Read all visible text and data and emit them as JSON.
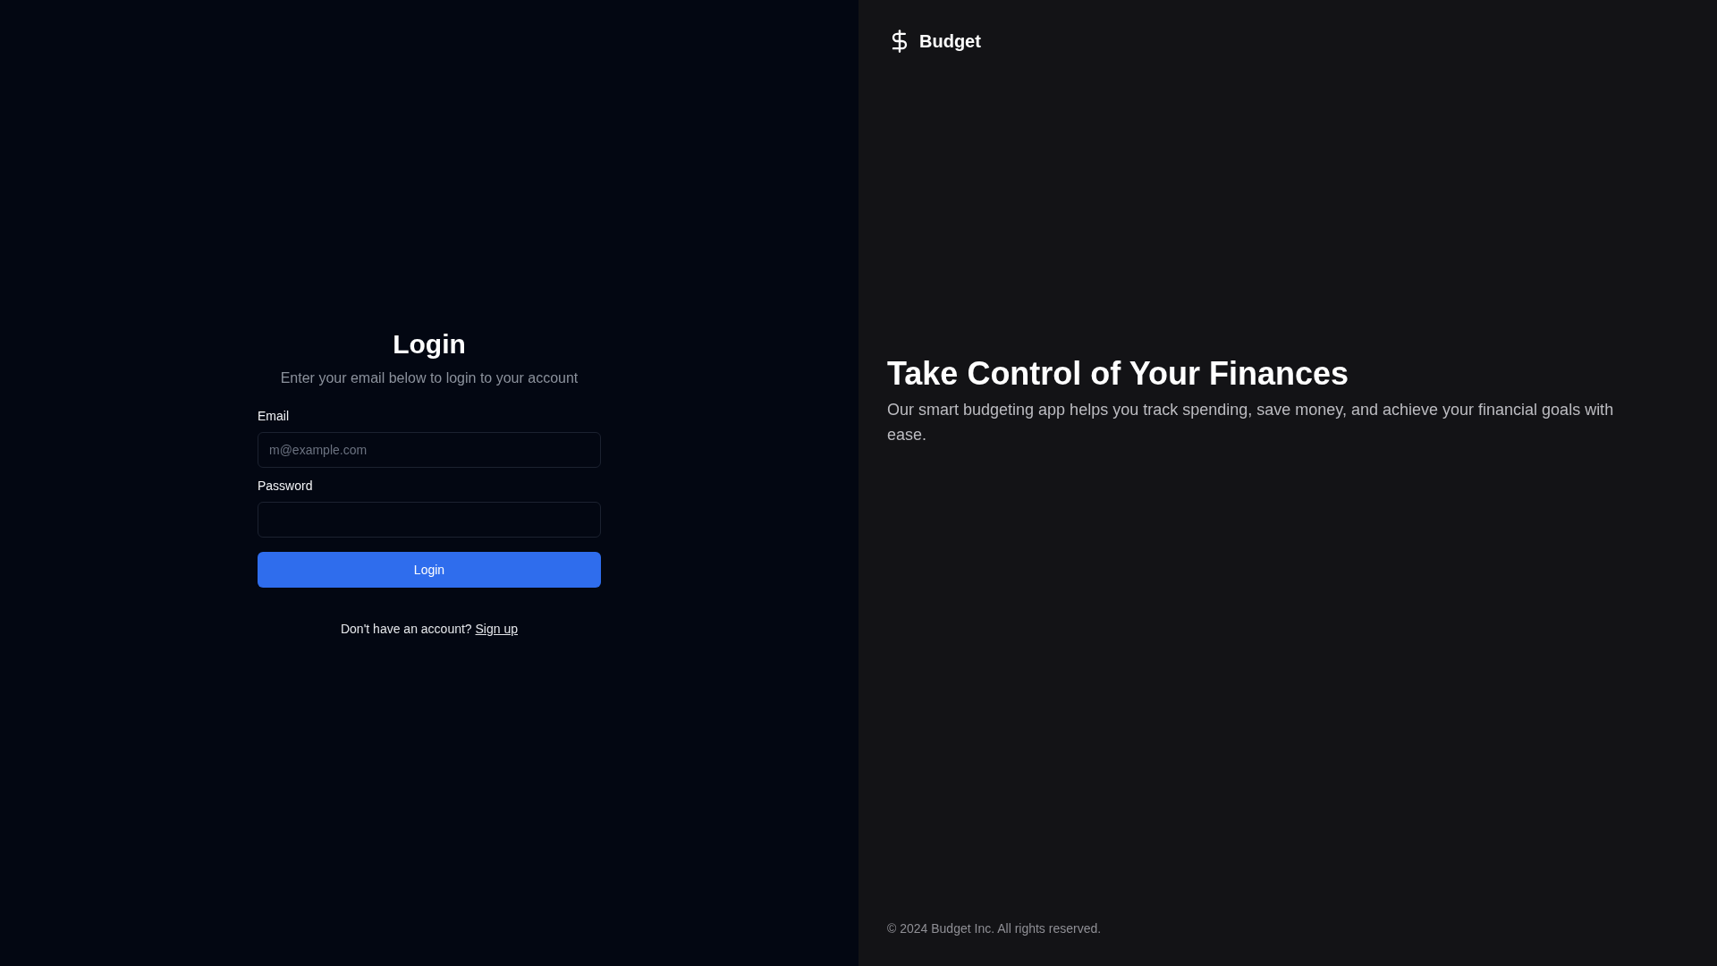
{
  "login": {
    "title": "Login",
    "subtitle": "Enter your email below to login to your account",
    "fields": [
      {
        "label": "Email",
        "placeholder": "m@example.com"
      },
      {
        "label": "Password"
      }
    ],
    "submit": "Login",
    "signup_prompt": "Don't have an account?",
    "signup_link": "Sign up"
  },
  "brand": {
    "name": "Budget"
  },
  "hero": {
    "title": "Take Control of Your Finances",
    "text": "Our smart budgeting app helps you track spending, save money, and achieve your financial goals with ease."
  },
  "footer": "© 2024 Budget Inc. All rights reserved."
}
